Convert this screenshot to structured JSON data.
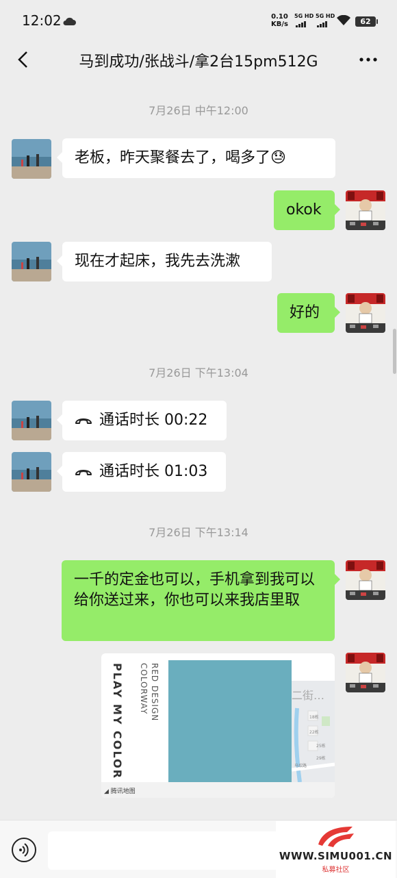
{
  "status_bar": {
    "time": "12:02",
    "speed_value": "0.10",
    "speed_unit": "KB/s",
    "network_1": "5G HD",
    "network_2": "5G HD",
    "battery": "62"
  },
  "header": {
    "title": "马到成功/张战斗/拿2台15pm512G"
  },
  "messages": [
    {
      "timestamp": "7月26日 中午12:00"
    },
    {
      "side": "left",
      "text": "老板，昨天聚餐去了，喝多了",
      "emoji": "😓"
    },
    {
      "side": "right",
      "text": "okok"
    },
    {
      "side": "left",
      "text": "现在才起床，我先去洗漱"
    },
    {
      "side": "right",
      "text": "好的"
    },
    {
      "timestamp": "7月26日 下午13:04"
    },
    {
      "side": "left",
      "call": "通话时长 00:22"
    },
    {
      "side": "left",
      "call": "通话时长 01:03"
    },
    {
      "timestamp": "7月26日 下午13:14"
    },
    {
      "side": "right",
      "text": "一千的定金也可以，手机拿到我可以给你送过来，你也可以来我店里取"
    }
  ],
  "location_card": {
    "vertical_text_1": "PLAY MY COLOR",
    "vertical_text_2a": "RED DESIGN",
    "vertical_text_2b": "COLORWAY",
    "address_fragment": "二街…",
    "map_labels": [
      "18栋",
      "22栋",
      "25栋",
      "29栋"
    ],
    "map_road": "马坎路",
    "provider": "腾讯地图"
  },
  "watermark": {
    "site": "WWW.SIMU001.CN",
    "cn": "私募社区"
  },
  "colors": {
    "background": "#ededed",
    "bubble_sent": "#95ec69",
    "bubble_received": "#ffffff",
    "timestamp": "#999999"
  }
}
